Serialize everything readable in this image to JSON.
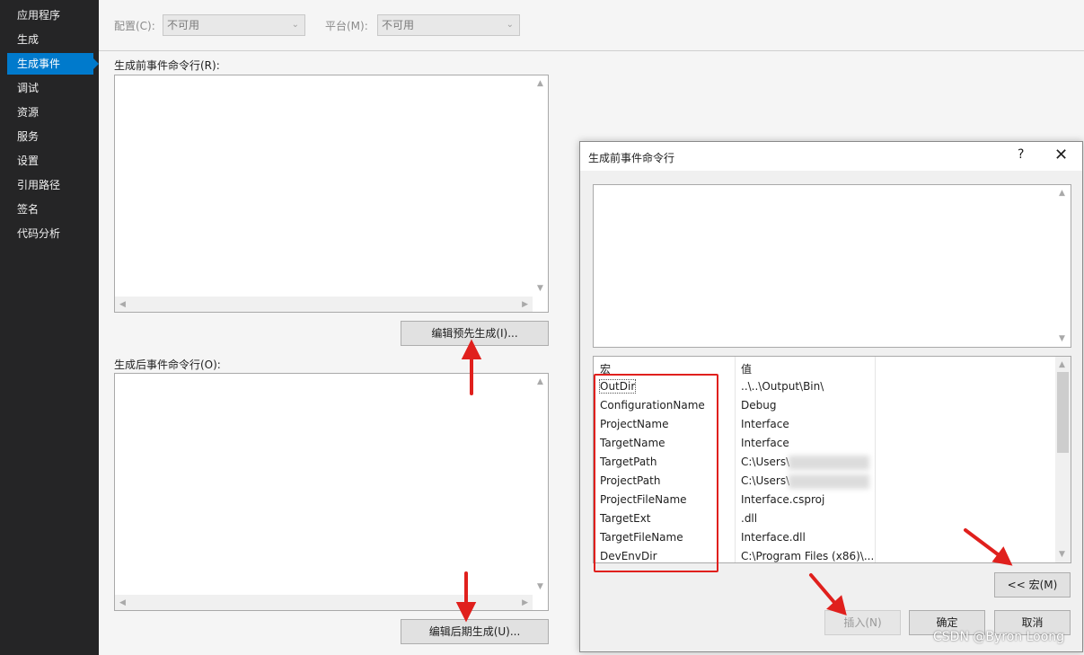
{
  "sidebar": {
    "items": [
      {
        "label": "应用程序"
      },
      {
        "label": "生成"
      },
      {
        "label": "生成事件",
        "active": true
      },
      {
        "label": "调试"
      },
      {
        "label": "资源"
      },
      {
        "label": "服务"
      },
      {
        "label": "设置"
      },
      {
        "label": "引用路径"
      },
      {
        "label": "签名"
      },
      {
        "label": "代码分析"
      }
    ]
  },
  "config": {
    "config_label": "配置(C):",
    "config_value": "不可用",
    "platform_label": "平台(M):",
    "platform_value": "不可用"
  },
  "prebuild": {
    "label": "生成前事件命令行(R):",
    "button": "编辑预先生成(I)..."
  },
  "postbuild": {
    "label": "生成后事件命令行(O):",
    "button": "编辑后期生成(U)..."
  },
  "dialog": {
    "title": "生成前事件命令行",
    "help": "?",
    "close": "✕",
    "col_macro": "宏",
    "col_value": "值",
    "rows": [
      {
        "name": "OutDir",
        "value": "..\\..\\Output\\Bin\\"
      },
      {
        "name": "ConfigurationName",
        "value": "Debug"
      },
      {
        "name": "ProjectName",
        "value": "Interface"
      },
      {
        "name": "TargetName",
        "value": "Interface"
      },
      {
        "name": "TargetPath",
        "value": "C:\\Users\\"
      },
      {
        "name": "ProjectPath",
        "value": "C:\\Users\\"
      },
      {
        "name": "ProjectFileName",
        "value": "Interface.csproj"
      },
      {
        "name": "TargetExt",
        "value": ".dll"
      },
      {
        "name": "TargetFileName",
        "value": "Interface.dll"
      },
      {
        "name": "DevEnvDir",
        "value": "C:\\Program Files (x86)\\..."
      }
    ],
    "macros_button": "<< 宏(M)",
    "insert_button": "插入(N)",
    "ok_button": "确定",
    "cancel_button": "取消"
  },
  "watermark": "CSDN @Byron Loong",
  "colors": {
    "sidebar_bg": "#252526",
    "active_item": "#007acc",
    "annotation_red": "#e0201d"
  }
}
